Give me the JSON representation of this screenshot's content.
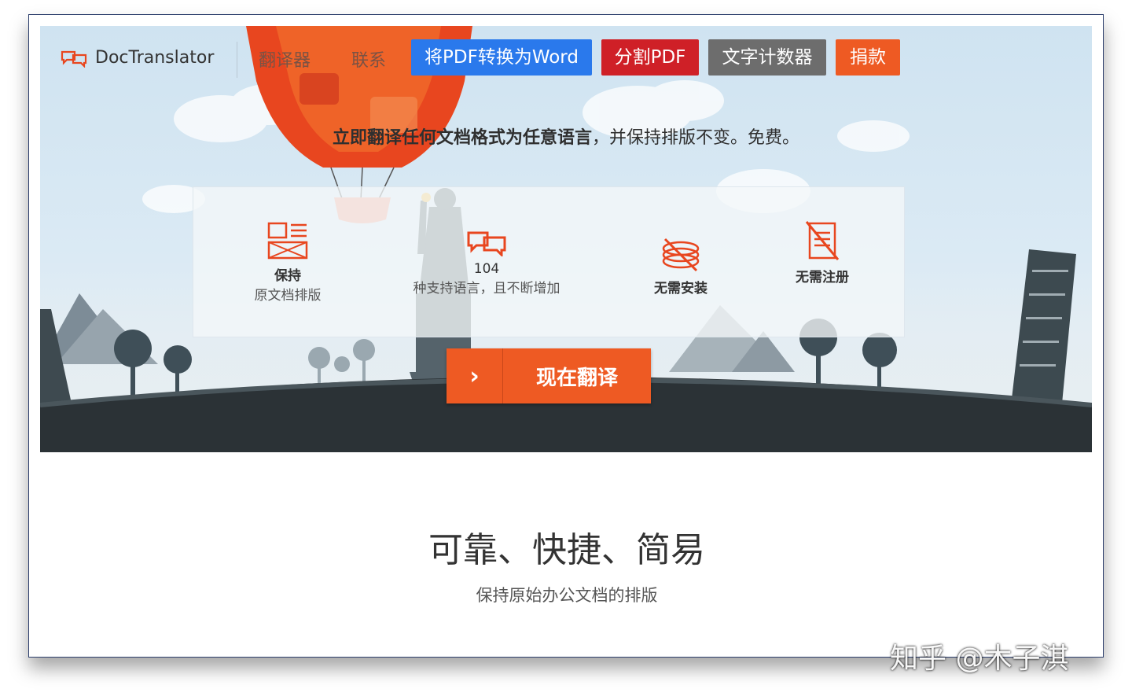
{
  "brand": {
    "name": "DocTranslator",
    "logo_icon": "speech-bubbles-icon"
  },
  "nav": {
    "translator": "翻译器",
    "contact": "联系"
  },
  "buttons": {
    "pdf_to_word": "将PDF转换为Word",
    "split_pdf": "分割PDF",
    "word_counter": "文字计数器",
    "donate": "捐款"
  },
  "tagline": {
    "bold": "立即翻译任何文档格式为任意语言",
    "rest": "，并保持排版不变。免费。"
  },
  "features": [
    {
      "icon": "document-layout-icon",
      "title": "保持",
      "subtitle": "原文档排版"
    },
    {
      "icon": "language-bubbles-icon",
      "number": "104",
      "subtitle": "种支持语言，且不断增加"
    },
    {
      "icon": "no-install-icon",
      "title": "无需安装"
    },
    {
      "icon": "no-register-icon",
      "title": "无需注册"
    }
  ],
  "cta": {
    "arrow": "›",
    "label": "现在翻译"
  },
  "section": {
    "heading": "可靠、快捷、简易",
    "subheading": "保持原始办公文档的排版"
  },
  "watermark": "知乎 @木子淇",
  "colors": {
    "accent": "#ee5a23",
    "blue": "#2a79ec",
    "red": "#cf2027",
    "gray": "#6d6d6d",
    "ground": "#2b3236"
  }
}
